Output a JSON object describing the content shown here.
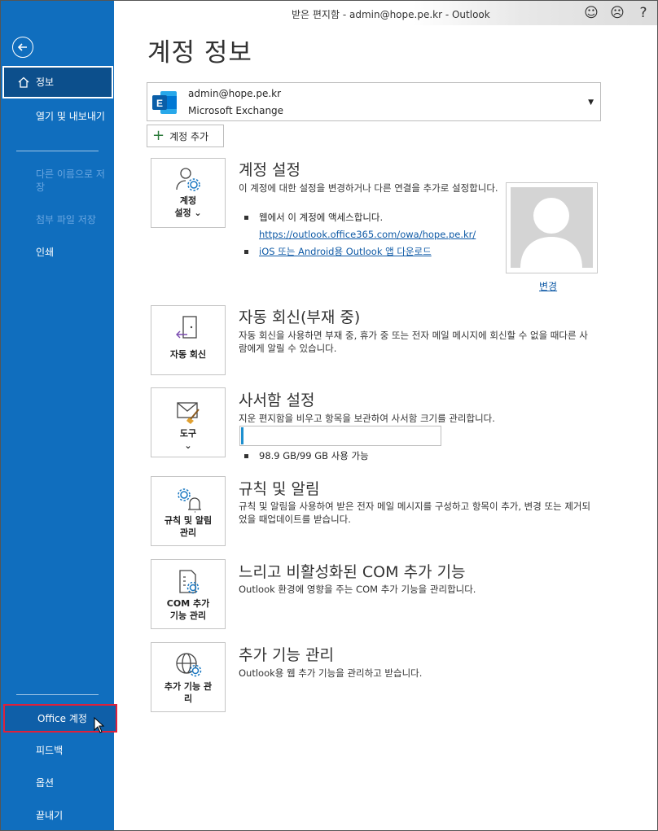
{
  "window": {
    "title": "받은 편지함 - admin@hope.pe.kr  -  Outlook",
    "icons": [
      "smiley-icon",
      "frown-icon",
      "help-icon"
    ],
    "help_glyph": "?"
  },
  "sidebar": {
    "info": "정보",
    "open_export": "열기 및 내보내기",
    "save_as": "다른 이름으로 저장",
    "save_attachment": "첨부 파일 저장",
    "print": "인쇄",
    "office_account": "Office 계정",
    "feedback": "피드백",
    "options": "옵션",
    "exit": "끝내기"
  },
  "main": {
    "page_title": "계정 정보",
    "account": {
      "email": "admin@hope.pe.kr",
      "type": "Microsoft Exchange",
      "logo_letter": "E"
    },
    "add_account": "계정 추가",
    "sections": {
      "account_settings": {
        "tile_label_1": "계정",
        "tile_label_2": "설정 ⌄",
        "title": "계정 설정",
        "desc": "이 계정에 대한 설정을 변경하거나 다른 연결을 추가로 설정합니다.",
        "bullet1": "웹에서 이 계정에 액세스합니다.",
        "link1": "https://outlook.office365.com/owa/hope.pe.kr/",
        "link2": "iOS 또는 Android용 Outlook 앱 다운로드",
        "change": "변경"
      },
      "auto_reply": {
        "tile_label": "자동 회신",
        "title": "자동 회신(부재 중)",
        "desc": "자동 회신을 사용하면 부재 중, 휴가 중 또는 전자 메일 메시지에 회신할 수 없을 때다른 사람에게 알릴 수 있습니다."
      },
      "mailbox": {
        "tile_label": "도구",
        "tile_caret": "⌄",
        "title": "사서함 설정",
        "desc": "지운 편지함을 비우고 항목을 보관하여 사서함 크기를 관리합니다.",
        "usage_fraction": 0.01,
        "usage_text": "98.9 GB/99 GB 사용 가능"
      },
      "rules": {
        "tile_label_1": "규칙 및 알림",
        "tile_label_2": "관리",
        "title": "규칙 및 알림",
        "desc": "규칙 및 알림을 사용하여 받은 전자 메일 메시지를 구성하고 항목이 추가, 변경 또는 제거되었을 때업데이트를 받습니다."
      },
      "com": {
        "tile_label_1": "COM 추가",
        "tile_label_2": "기능 관리",
        "title": "느리고 비활성화된 COM 추가 기능",
        "desc": "Outlook 환경에 영향을 주는 COM 추가 기능을 관리합니다."
      },
      "addins": {
        "tile_label_1": "추가 기능 관",
        "tile_label_2": "리",
        "title": "추가 기능 관리",
        "desc": "Outlook용 웹 추가 기능을 관리하고 받습니다."
      }
    }
  },
  "colors": {
    "sidebar": "#106ebe",
    "sidebar_selected": "#0c4f8c",
    "highlight_border": "#e0203a",
    "progress": "#1d8fcf",
    "link": "#0f5aa6"
  }
}
